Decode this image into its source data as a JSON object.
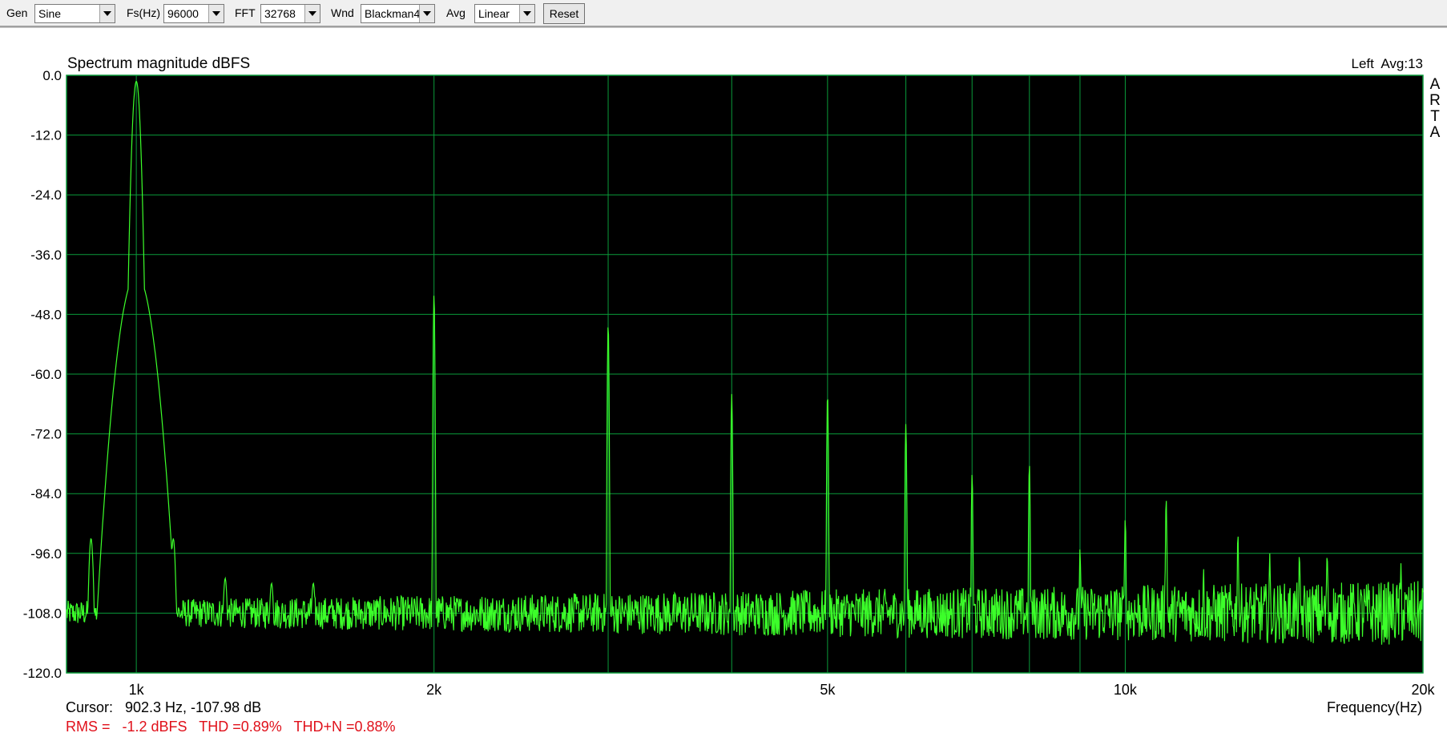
{
  "toolbar": {
    "gen_label": "Gen",
    "gen_value": "Sine",
    "fs_label": "Fs(Hz)",
    "fs_value": "96000",
    "fft_label": "FFT",
    "fft_value": "32768",
    "wnd_label": "Wnd",
    "wnd_value": "Blackman4",
    "avg_label": "Avg",
    "avg_value": "Linear",
    "reset_label": "Reset"
  },
  "plot": {
    "title": "Spectrum magnitude dBFS",
    "channel_info": "Left  Avg:13",
    "watermark": [
      "A",
      "R",
      "T",
      "A"
    ],
    "xlabel": "Frequency(Hz)",
    "cursor": "Cursor:   902.3 Hz, -107.98 dB",
    "stats": "RMS =   -1.2 dBFS   THD =0.89%   THD+N =0.88%",
    "colors": {
      "background": "#000000",
      "grid": "#0a9a3a",
      "trace": "#3cff2a",
      "stats": "#e0101a"
    }
  },
  "chart_data": {
    "type": "line",
    "title": "Spectrum magnitude dBFS",
    "xlabel": "Frequency(Hz)",
    "x_scale": "log",
    "xlim": [
      850,
      20000
    ],
    "ylim": [
      -120,
      0
    ],
    "y_ticks": [
      0,
      -12,
      -24,
      -36,
      -48,
      -60,
      -72,
      -84,
      -96,
      -108,
      -120
    ],
    "y_tick_labels": [
      "0.0",
      "-12.0",
      "-24.0",
      "-36.0",
      "-48.0",
      "-60.0",
      "-72.0",
      "-84.0",
      "-96.0",
      "-108.0",
      "-120.0"
    ],
    "x_tick_labels": [
      {
        "value": 1000,
        "label": "1k"
      },
      {
        "value": 2000,
        "label": "2k"
      },
      {
        "value": 5000,
        "label": "5k"
      },
      {
        "value": 10000,
        "label": "10k"
      },
      {
        "value": 20000,
        "label": "20k"
      }
    ],
    "x_grid": [
      1000,
      2000,
      3000,
      4000,
      5000,
      6000,
      7000,
      8000,
      9000,
      10000,
      20000
    ],
    "grid": true,
    "noise_floor_db": -108,
    "peaks": [
      {
        "x": 1000,
        "y": -1.2
      },
      {
        "x": 2000,
        "y": -44
      },
      {
        "x": 3000,
        "y": -50
      },
      {
        "x": 4000,
        "y": -64
      },
      {
        "x": 5000,
        "y": -64
      },
      {
        "x": 6000,
        "y": -70
      },
      {
        "x": 7000,
        "y": -80
      },
      {
        "x": 8000,
        "y": -78
      },
      {
        "x": 9000,
        "y": -95
      },
      {
        "x": 10000,
        "y": -89
      },
      {
        "x": 11000,
        "y": -85
      },
      {
        "x": 12000,
        "y": -99
      },
      {
        "x": 13000,
        "y": -92
      },
      {
        "x": 14000,
        "y": -96
      },
      {
        "x": 15000,
        "y": -96
      },
      {
        "x": 16000,
        "y": -96
      },
      {
        "x": 19000,
        "y": -98
      }
    ],
    "sidelobes": [
      {
        "x": 900,
        "y": -93
      },
      {
        "x": 960,
        "y": -95
      },
      {
        "x": 1045,
        "y": -95
      },
      {
        "x": 1090,
        "y": -93
      },
      {
        "x": 1230,
        "y": -101
      },
      {
        "x": 1370,
        "y": -102
      },
      {
        "x": 1510,
        "y": -102
      }
    ]
  }
}
